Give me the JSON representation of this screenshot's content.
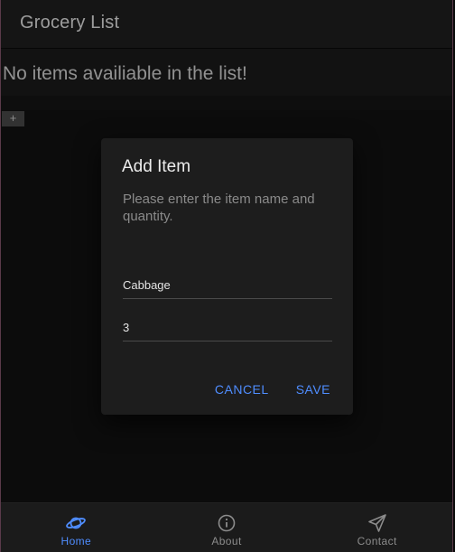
{
  "toolbar": {
    "title": "Grocery List"
  },
  "list": {
    "empty_message": "No items availiable in the list!"
  },
  "add_button": {
    "label": "+"
  },
  "dialog": {
    "title": "Add Item",
    "message": "Please enter the item name and quantity.",
    "name_field": {
      "value": "Cabbage"
    },
    "quantity_field": {
      "value": "3"
    },
    "cancel_label": "CANCEL",
    "save_label": "SAVE"
  },
  "tabs": [
    {
      "label": "Home",
      "icon": "planet-icon",
      "active": true
    },
    {
      "label": "About",
      "icon": "info-icon",
      "active": false
    },
    {
      "label": "Contact",
      "icon": "send-icon",
      "active": false
    }
  ],
  "colors": {
    "accent": "#4f8dff",
    "background": "#121212",
    "dialog": "#1d1d1d"
  }
}
